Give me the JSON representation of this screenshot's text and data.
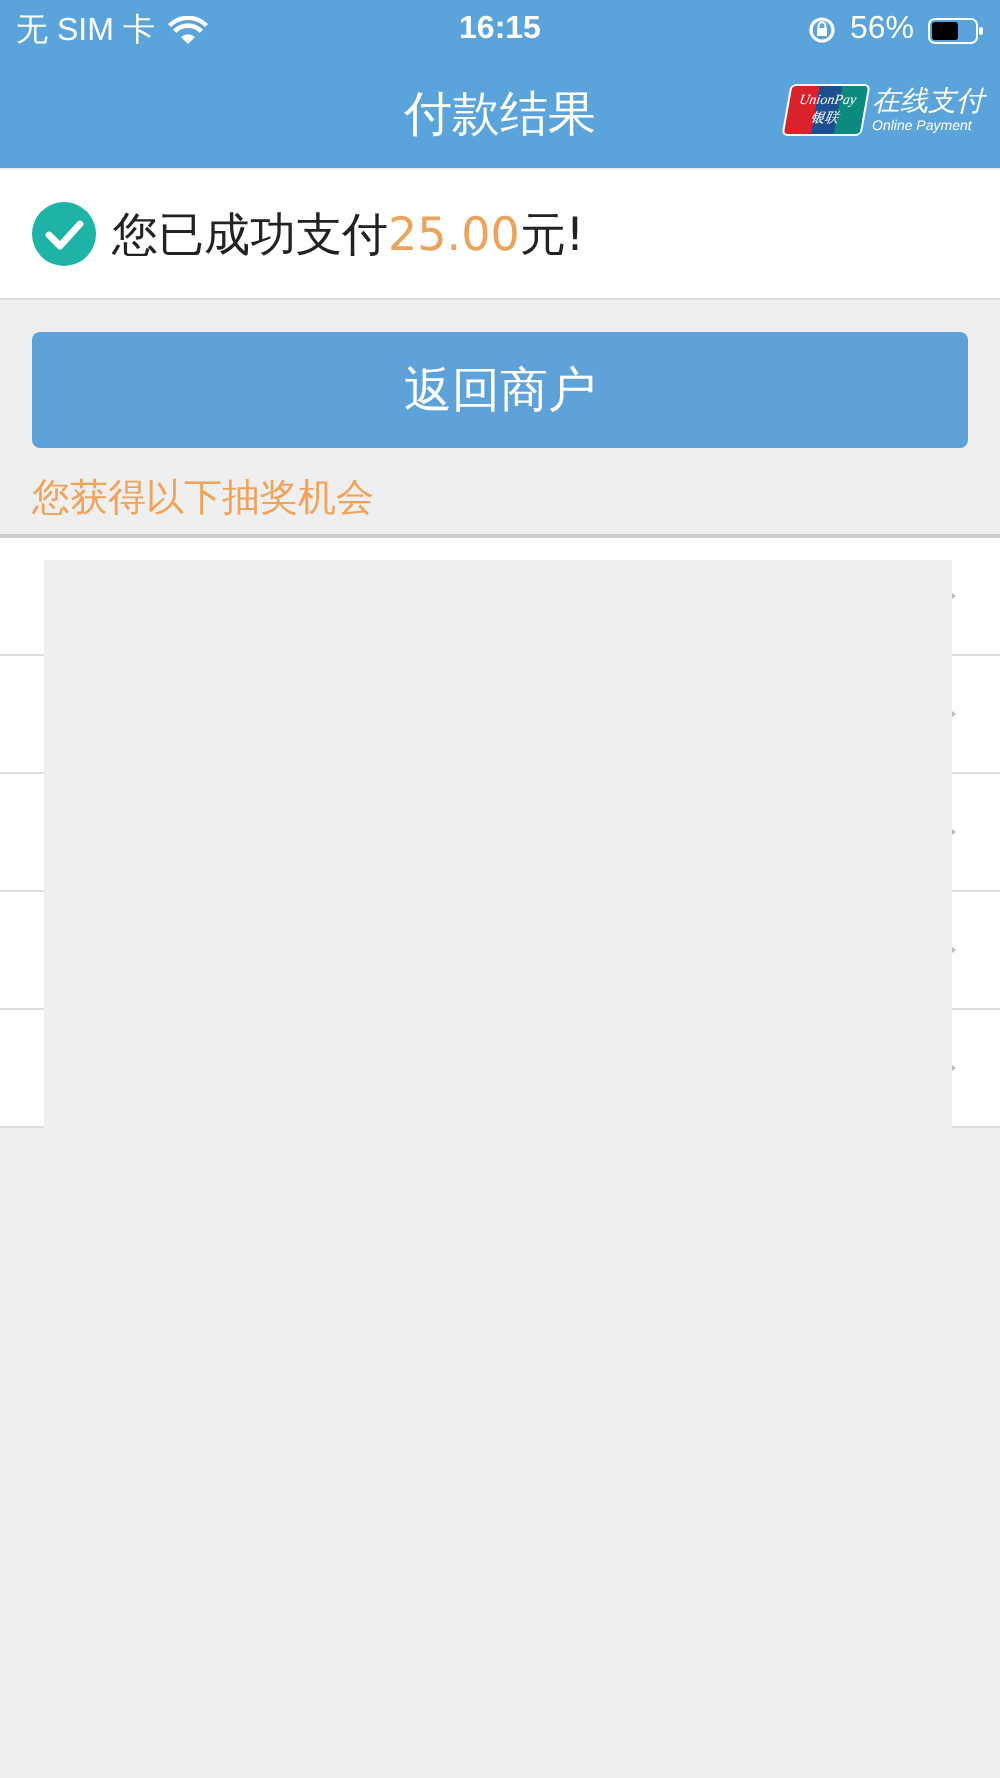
{
  "status_bar": {
    "carrier": "无 SIM 卡",
    "time": "16:15",
    "battery": "56%"
  },
  "nav": {
    "title": "付款结果",
    "logo": {
      "card_top": "UnionPay",
      "card_bottom": "银联",
      "title": "在线支付",
      "subtitle": "Online Payment"
    }
  },
  "result": {
    "message": "您已成功支付",
    "amount": "25.00",
    "suffix": "元!"
  },
  "return_button": "返回商户",
  "prize_note": "您获得以下抽奖机会",
  "rows": [
    {
      "kind": "link"
    },
    {
      "kind": "link"
    },
    {
      "kind": "link"
    },
    {
      "kind": "link"
    },
    {
      "kind": "link"
    }
  ],
  "cover": {
    "kind": "redaction"
  }
}
